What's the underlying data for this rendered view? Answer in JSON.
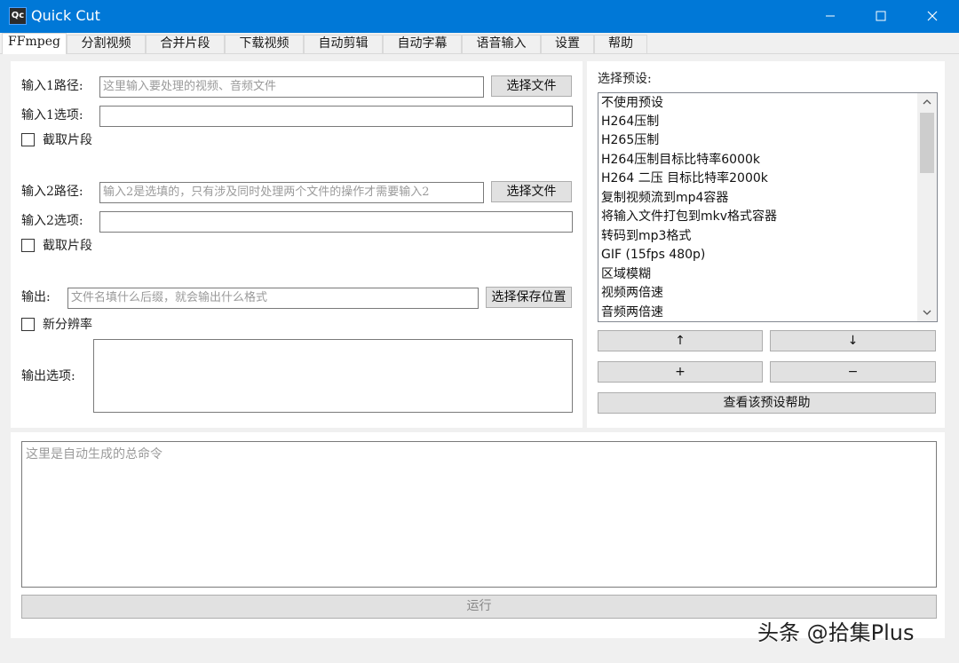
{
  "window": {
    "logo_text": "Qc",
    "title": "Quick Cut"
  },
  "tabs": [
    {
      "label": "FFmpeg",
      "active": true
    },
    {
      "label": "分割视频"
    },
    {
      "label": "合并片段"
    },
    {
      "label": "下载视频"
    },
    {
      "label": "自动剪辑"
    },
    {
      "label": "自动字幕"
    },
    {
      "label": "语音输入"
    },
    {
      "label": "设置"
    },
    {
      "label": "帮助"
    }
  ],
  "input1": {
    "path_label": "输入1路径:",
    "path_placeholder": "这里输入要处理的视频、音频文件",
    "choose_button": "选择文件",
    "options_label": "输入1选项:",
    "options_value": "",
    "clip_label": "截取片段",
    "clip_checked": false
  },
  "input2": {
    "path_label": "输入2路径:",
    "path_placeholder": "输入2是选填的，只有涉及同时处理两个文件的操作才需要输入2",
    "choose_button": "选择文件",
    "options_label": "输入2选项:",
    "options_value": "",
    "clip_label": "截取片段",
    "clip_checked": false
  },
  "output": {
    "label": "输出:",
    "placeholder": "文件名填什么后缀，就会输出什么格式",
    "save_button": "选择保存位置",
    "resolution_label": "新分辨率",
    "resolution_checked": false,
    "options_label": "输出选项:",
    "options_value": ""
  },
  "presets": {
    "label": "选择预设:",
    "items": [
      "不使用预设",
      "H264压制",
      "H265压制",
      "H264压制目标比特率6000k",
      "H264 二压 目标比特率2000k",
      "复制视频流到mp4容器",
      "将输入文件打包到mkv格式容器",
      "转码到mp3格式",
      "GIF (15fps 480p)",
      "区域模糊",
      "视频两倍速",
      "音频两倍速"
    ],
    "up_button": "↑",
    "down_button": "↓",
    "add_button": "+",
    "remove_button": "−",
    "help_button": "查看该预设帮助"
  },
  "command": {
    "placeholder": "这里是自动生成的总命令"
  },
  "run_button": "运行",
  "watermark": "头条 @拾集Plus"
}
